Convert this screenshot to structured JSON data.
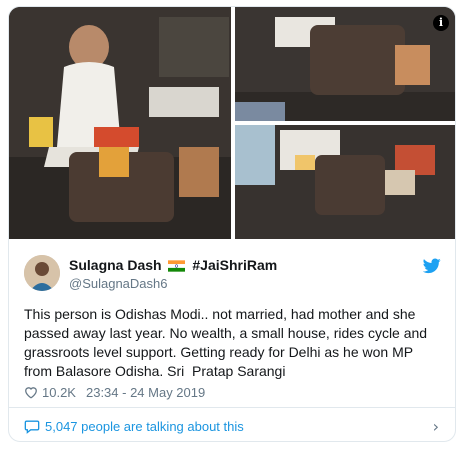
{
  "tweet": {
    "author_name": "Sulagna Dash",
    "author_tag": "#JaiShriRam",
    "handle": "@SulagnaDash6",
    "text": "This person is Odishas Modi.. not married, had mother and she passed away last year. No wealth, a small house, rides cycle and grassroots level support. Getting ready for Delhi as he won MP from Balasore Odisha. Sri  Pratap Sarangi",
    "likes": "10.2K",
    "timestamp": "23:34 - 24 May 2019",
    "talking_about": "5,047 people are talking about this",
    "info_glyph": "i"
  },
  "icons": {
    "info": "info-icon",
    "brand": "twitter-bird-icon",
    "like": "heart-icon",
    "conversation": "speech-bubble-icon",
    "expand": "chevron-right-icon"
  },
  "colors": {
    "link": "#1b95e0",
    "muted": "#657786",
    "border": "#e1e8ed",
    "brand": "#1da1f2"
  }
}
